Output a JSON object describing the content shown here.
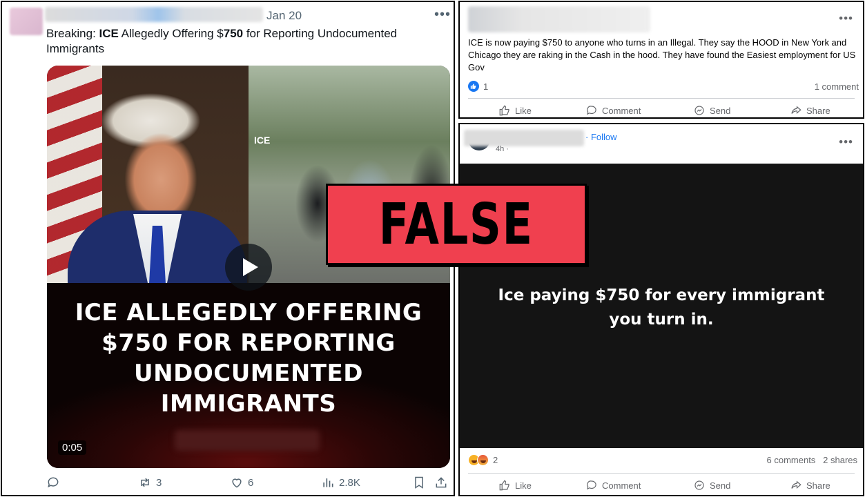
{
  "twitter_post": {
    "date": "Jan 20",
    "more_label": "•••",
    "text_prefix": "Breaking: ",
    "text_bold_1": "ICE",
    "text_mid": " Allegedly Offering $",
    "text_bold_2": "750",
    "text_suffix": " for Reporting Undocumented Immigrants",
    "video": {
      "headline": "ICE ALLEGEDLY OFFERING $750 FOR REPORTING UNDOCUMENTED IMMIGRANTS",
      "duration": "0:05",
      "sign_text": "ICE"
    },
    "actions": {
      "reply_icon": "reply-icon",
      "retweet_count": "3",
      "like_count": "6",
      "views_count": "2.8K"
    }
  },
  "facebook_post_1": {
    "more_label": "•••",
    "text": "ICE is now paying $750 to anyone who turns in an Illegal. They say the HOOD in New York and Chicago they are raking in the Cash in the hood. They have found the Easiest employment for US Gov",
    "reaction_count": "1",
    "comment_count": "1 comment",
    "actions": {
      "like": "Like",
      "comment": "Comment",
      "send": "Send",
      "share": "Share"
    }
  },
  "facebook_post_2": {
    "follow_label": "· Follow",
    "timestamp": "4h · ",
    "more_label": "•••",
    "text": "Ice paying $750 for every immigrant you turn in.",
    "reaction_count": "2",
    "stats": "6 comments   2 shares",
    "actions": {
      "like": "Like",
      "comment": "Comment",
      "send": "Send",
      "share": "Share"
    }
  },
  "verdict": {
    "label": "FALSE",
    "color": "#f0404f"
  },
  "colors": {
    "twitter_secondary": "#536471",
    "facebook_blue": "#1877f2",
    "facebook_secondary": "#65676b"
  }
}
